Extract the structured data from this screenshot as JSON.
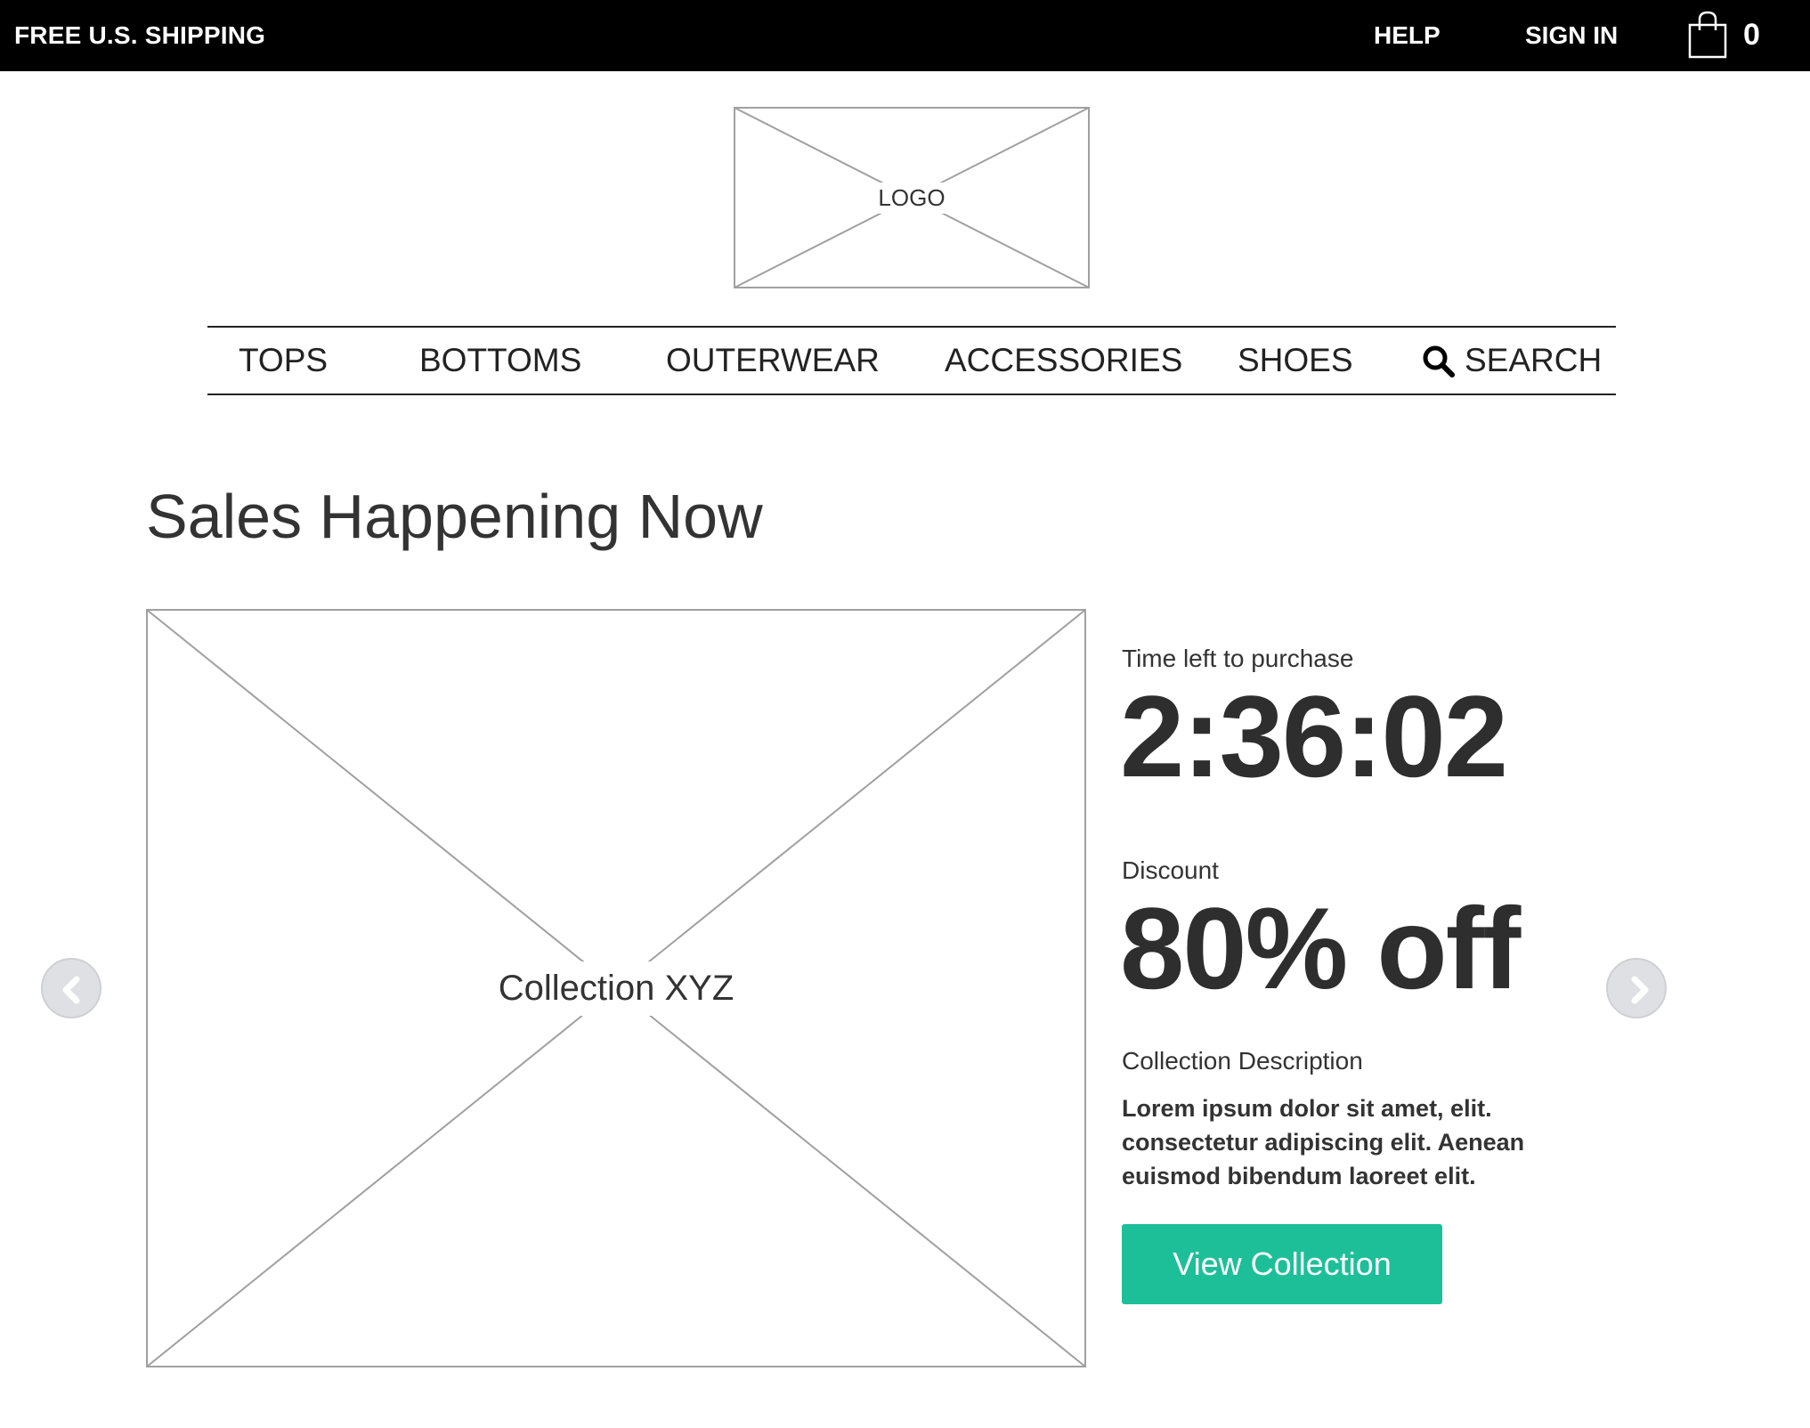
{
  "topbar": {
    "promo": "FREE U.S. SHIPPING",
    "help": "HELP",
    "sign_in": "SIGN IN",
    "cart_icon": "shopping-bag-icon",
    "cart_count": "0"
  },
  "logo": {
    "label": "LOGO"
  },
  "nav": {
    "items": [
      "TOPS",
      "BOTTOMS",
      "OUTERWEAR",
      "ACCESSORIES",
      "SHOES"
    ],
    "search_icon": "search-icon",
    "search_label": "SEARCH"
  },
  "section": {
    "title": "Sales Happening Now"
  },
  "carousel": {
    "prev_icon": "chevron-left-icon",
    "next_icon": "chevron-right-icon",
    "image_label": "Collection XYZ"
  },
  "details": {
    "time_label": "Time left to purchase",
    "time_value": "2:36:02",
    "discount_label": "Discount",
    "discount_value": "80% off",
    "description_label": "Collection Description",
    "description_lines": [
      "Lorem ipsum dolor sit amet, elit.",
      "consectetur adipiscing elit. Aenean",
      "euismod bibendum laoreet elit."
    ],
    "button_label": "View Collection"
  },
  "colors": {
    "topbar_bg": "#000000",
    "button_bg": "#1dbf99",
    "arrow_bg": "#dfe0e3",
    "placeholder_stroke": "#a0a0a0"
  }
}
